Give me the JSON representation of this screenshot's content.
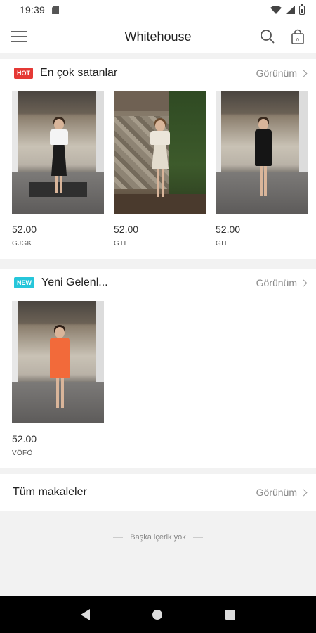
{
  "status_bar": {
    "time": "19:39"
  },
  "app_bar": {
    "title": "Whitehouse"
  },
  "best_sellers": {
    "badge": "HOT",
    "title": "En çok satanlar",
    "view_label": "Görünüm",
    "products": [
      {
        "price": "52.00",
        "code": "GJGK"
      },
      {
        "price": "52.00",
        "code": "GTI"
      },
      {
        "price": "52.00",
        "code": "GIT"
      }
    ]
  },
  "new_arrivals": {
    "badge": "NEW",
    "title": "Yeni Gelenl...",
    "view_label": "Görünüm",
    "products": [
      {
        "price": "52.00",
        "code": "VÖFÖ"
      }
    ]
  },
  "all_articles": {
    "title": "Tüm makaleler",
    "view_label": "Görünüm"
  },
  "footer": {
    "no_more_content": "Başka içerik yok"
  },
  "colors": {
    "hot_badge": "#e53935",
    "new_badge": "#26c6da"
  }
}
